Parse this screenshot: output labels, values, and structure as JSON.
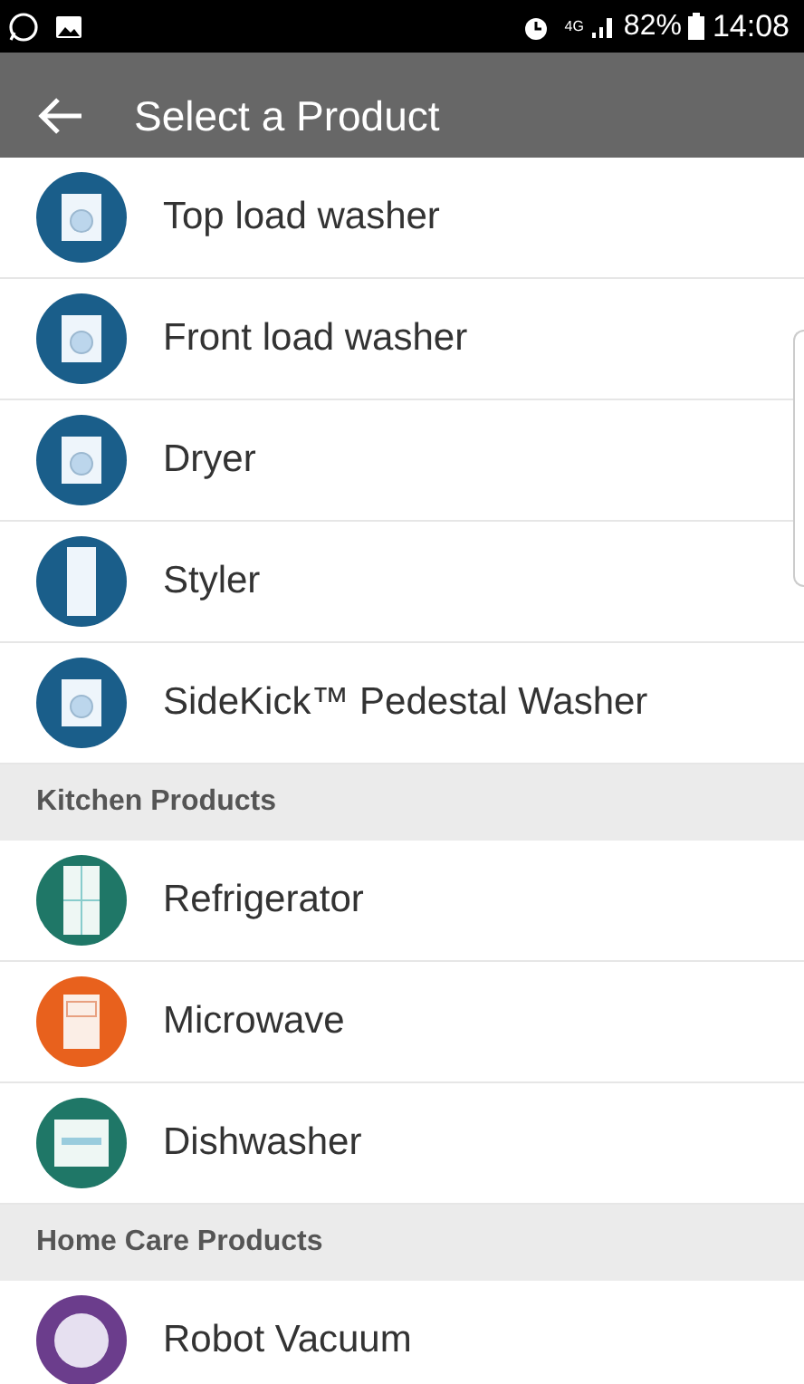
{
  "status_bar": {
    "network": "4G",
    "battery": "82%",
    "time": "14:08"
  },
  "app_bar": {
    "title": "Select a Product"
  },
  "sections": [
    {
      "items": [
        {
          "label": "Top load washer",
          "color": "#1a5e8a"
        },
        {
          "label": "Front load washer",
          "color": "#1a5e8a"
        },
        {
          "label": "Dryer",
          "color": "#1a5e8a"
        },
        {
          "label": "Styler",
          "color": "#1a5e8a"
        },
        {
          "label": "SideKick™ Pedestal Washer",
          "color": "#1a5e8a"
        }
      ]
    },
    {
      "header": "Kitchen Products",
      "items": [
        {
          "label": "Refrigerator",
          "color": "#1f7767"
        },
        {
          "label": "Microwave",
          "color": "#e8611d"
        },
        {
          "label": "Dishwasher",
          "color": "#1f7767"
        }
      ]
    },
    {
      "header": "Home Care Products",
      "items": [
        {
          "label": "Robot Vacuum",
          "color": "#6b3d8c"
        }
      ]
    }
  ]
}
